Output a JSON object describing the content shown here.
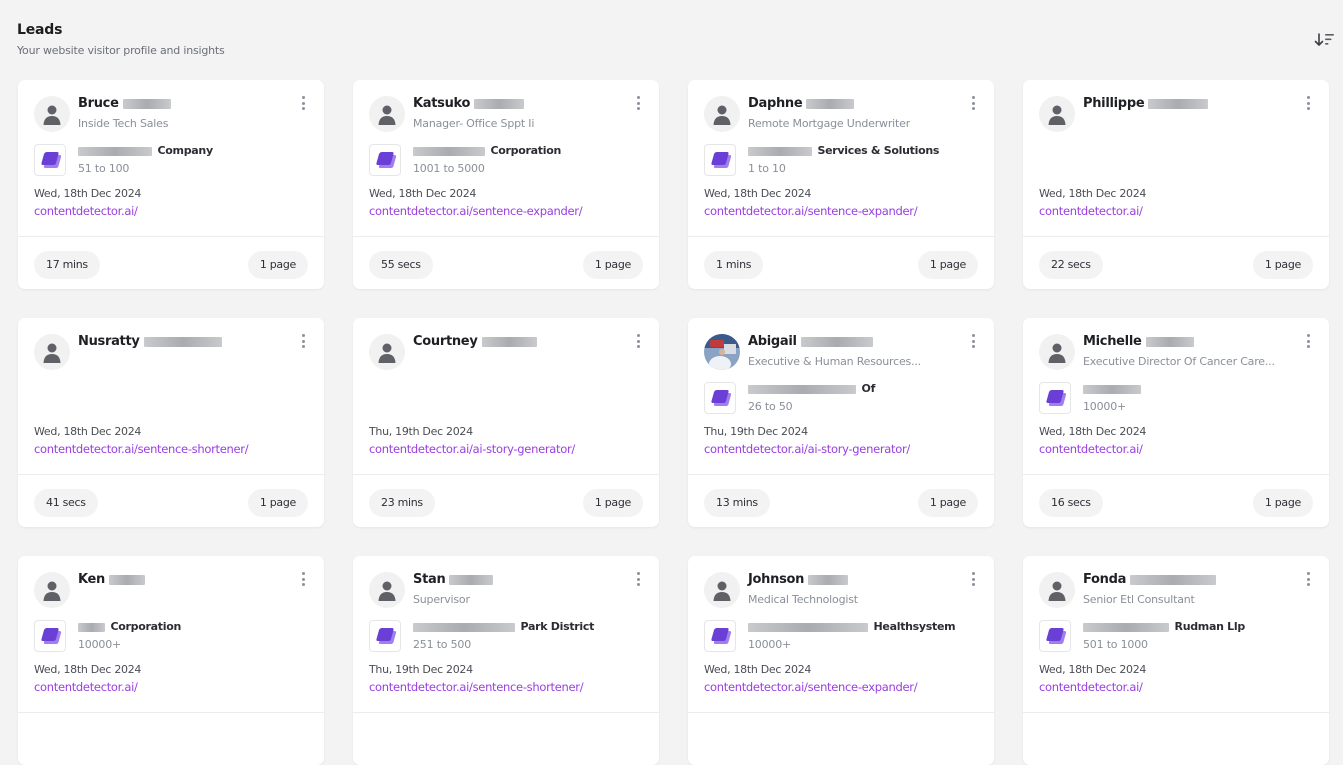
{
  "header": {
    "title": "Leads",
    "subtitle": "Your website visitor profile and insights",
    "sort_icon": "sort-descending-icon"
  },
  "brand": {
    "accent": "#9a3ee0",
    "logo_color": "#6a3fd6"
  },
  "leads": [
    {
      "first_name": "Bruce",
      "last_name_redacted": true,
      "job_title": "Inside Tech Sales",
      "company_suffix": "Company",
      "company_size": "51 to 100",
      "date": "Wed, 18th Dec 2024",
      "url": "contentdetector.ai/",
      "duration": "17 mins",
      "pages": "1 page",
      "avatar": "default"
    },
    {
      "first_name": "Katsuko",
      "last_name_redacted": true,
      "job_title": "Manager- Office Sppt Ii",
      "company_suffix": "Corporation",
      "company_size": "1001 to 5000",
      "date": "Wed, 18th Dec 2024",
      "url": "contentdetector.ai/sentence-expander/",
      "duration": "55 secs",
      "pages": "1 page",
      "avatar": "default"
    },
    {
      "first_name": "Daphne",
      "last_name_redacted": true,
      "job_title": "Remote Mortgage Underwriter",
      "company_suffix": "Services & Solutions",
      "company_size": "1 to 10",
      "date": "Wed, 18th Dec 2024",
      "url": "contentdetector.ai/sentence-expander/",
      "duration": "1 mins",
      "pages": "1 page",
      "avatar": "default"
    },
    {
      "first_name": "Phillippe",
      "last_name_redacted": true,
      "job_title": "",
      "company_suffix": "",
      "company_size": "",
      "date": "Wed, 18th Dec 2024",
      "url": "contentdetector.ai/",
      "duration": "22 secs",
      "pages": "1 page",
      "avatar": "default"
    },
    {
      "first_name": "Nusratty",
      "last_name_redacted": true,
      "job_title": "",
      "company_suffix": "",
      "company_size": "",
      "date": "Wed, 18th Dec 2024",
      "url": "contentdetector.ai/sentence-shortener/",
      "duration": "41 secs",
      "pages": "1 page",
      "avatar": "default"
    },
    {
      "first_name": "Courtney",
      "last_name_redacted": true,
      "job_title": "",
      "company_suffix": "",
      "company_size": "",
      "date": "Thu, 19th Dec 2024",
      "url": "contentdetector.ai/ai-story-generator/",
      "duration": "23 mins",
      "pages": "1 page",
      "avatar": "default"
    },
    {
      "first_name": "Abigail",
      "last_name_redacted": true,
      "job_title": "Executive & Human Resources...",
      "company_suffix": "Of",
      "company_size": "26 to 50",
      "date": "Thu, 19th Dec 2024",
      "url": "contentdetector.ai/ai-story-generator/",
      "duration": "13 mins",
      "pages": "1 page",
      "avatar": "photo"
    },
    {
      "first_name": "Michelle",
      "last_name_redacted": true,
      "job_title": "Executive Director Of Cancer Care...",
      "company_suffix": "",
      "company_size": "10000+",
      "date": "Wed, 18th Dec 2024",
      "url": "contentdetector.ai/",
      "duration": "16 secs",
      "pages": "1 page",
      "avatar": "default"
    },
    {
      "first_name": "Ken",
      "last_name_redacted": true,
      "job_title": "",
      "company_suffix": "Corporation",
      "company_size": "10000+",
      "date": "Wed, 18th Dec 2024",
      "url": "contentdetector.ai/",
      "duration": "",
      "pages": "",
      "avatar": "default"
    },
    {
      "first_name": "Stan",
      "last_name_redacted": true,
      "job_title": "Supervisor",
      "company_suffix": "Park District",
      "company_size": "251 to 500",
      "date": "Thu, 19th Dec 2024",
      "url": "contentdetector.ai/sentence-shortener/",
      "duration": "",
      "pages": "",
      "avatar": "default"
    },
    {
      "first_name": "Johnson",
      "last_name_redacted": true,
      "job_title": "Medical Technologist",
      "company_suffix": "Healthsystem",
      "company_size": "10000+",
      "date": "Wed, 18th Dec 2024",
      "url": "contentdetector.ai/sentence-expander/",
      "duration": "",
      "pages": "",
      "avatar": "default"
    },
    {
      "first_name": "Fonda",
      "last_name_redacted": true,
      "job_title": "Senior Etl Consultant",
      "company_suffix": "Rudman Llp",
      "company_size": "501 to 1000",
      "date": "Wed, 18th Dec 2024",
      "url": "contentdetector.ai/",
      "duration": "",
      "pages": "",
      "avatar": "default"
    }
  ]
}
